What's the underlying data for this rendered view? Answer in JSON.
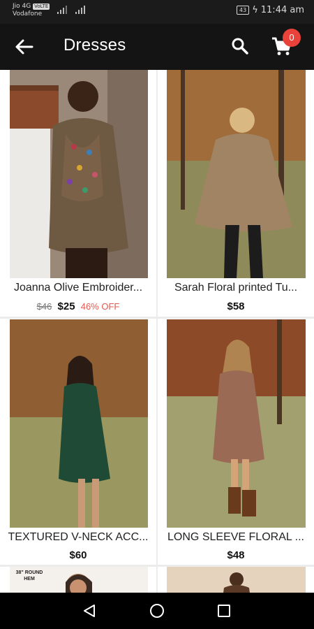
{
  "status": {
    "carrier1": "Jio 4G",
    "carrier1_tag": "VoLTE",
    "carrier2": "Vodafone",
    "battery": "43",
    "time": "11:44 am"
  },
  "toolbar": {
    "title": "Dresses",
    "cart_count": "0"
  },
  "products": [
    {
      "name": "Joanna Olive Embroider...",
      "old_price": "$46",
      "price": "$25",
      "discount": "46% OFF"
    },
    {
      "name": "Sarah Floral printed Tu...",
      "old_price": "",
      "price": "$58",
      "discount": ""
    },
    {
      "name": "TEXTURED V-NECK ACC...",
      "old_price": "",
      "price": "$60",
      "discount": ""
    },
    {
      "name": "LONG SLEEVE FLORAL ...",
      "old_price": "",
      "price": "$48",
      "discount": ""
    }
  ],
  "peek_label": "38\" ROUND HEM",
  "colors": {
    "toolbar": "#141414",
    "badge": "#e8423a",
    "discount": "#e35a52"
  },
  "icons": [
    "back-arrow-icon",
    "search-icon",
    "cart-icon",
    "nav-back-icon",
    "nav-home-icon",
    "nav-recents-icon"
  ]
}
